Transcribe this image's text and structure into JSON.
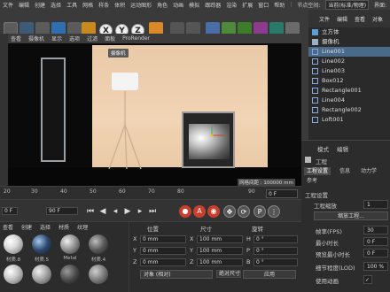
{
  "menu": {
    "items": [
      "文件",
      "编辑",
      "创建",
      "选择",
      "工具",
      "网格",
      "样条",
      "体积",
      "运动图形",
      "角色",
      "动画",
      "模拟",
      "跟踪器",
      "渲染",
      "扩展",
      "窗口",
      "帮助"
    ],
    "node_space_label": "节点空间:",
    "node_space_value": "当前(标准/物理)",
    "layout_label": "界面:"
  },
  "toolbar": {
    "xyz": [
      "X",
      "Y",
      "Z"
    ]
  },
  "viewport": {
    "menu": [
      "查看",
      "摄像机",
      "显示",
      "选项",
      "过滤",
      "面板",
      "ProRender"
    ],
    "camera_tag": "摄像机",
    "grid_spacing": "网格间距 : 100000 mm"
  },
  "timeline": {
    "ticks": [
      "20",
      "30",
      "40",
      "50",
      "60",
      "70",
      "80",
      "90"
    ],
    "current_frame": "0 F",
    "start_frame": "0 F",
    "end_frame": "90 F"
  },
  "materials": {
    "menu": [
      "查看",
      "创建",
      "编辑",
      "功能",
      "纹理"
    ],
    "tabs": [
      "查看",
      "创建",
      "选择",
      "材质",
      "纹理"
    ],
    "row1": [
      {
        "label": "材质.8",
        "color": "#d8d8d8"
      },
      {
        "label": "材质.5",
        "color": "#2e4a6e"
      },
      {
        "label": "Metal",
        "color": "#8c8c8c"
      },
      {
        "label": "材质.4",
        "color": "#5a5a5a"
      }
    ],
    "row2_colors": [
      "#c4c4c4",
      "#a7a7a7",
      "#4a4a4a",
      "#7a7a7a"
    ]
  },
  "coordinates": {
    "col_position": "位置",
    "col_size": "尺寸",
    "col_rotation": "旋转",
    "rows": [
      {
        "axis": "X",
        "pos": "0 mm",
        "size": "100 mm",
        "rot_axis": "H",
        "rot": "0 °"
      },
      {
        "axis": "Y",
        "pos": "0 mm",
        "size": "100 mm",
        "rot_axis": "P",
        "rot": "0 °"
      },
      {
        "axis": "Z",
        "pos": "0 mm",
        "size": "100 mm",
        "rot_axis": "B",
        "rot": "0 °"
      }
    ],
    "object_mode": "对象 (相对)",
    "size_mode": "绝对尺寸",
    "apply_label": "应用"
  },
  "objects": {
    "tabs": [
      "文件",
      "编辑",
      "查看",
      "对象"
    ],
    "items": [
      {
        "name": "立方体",
        "selected": false,
        "color": "#5aa0d8"
      },
      {
        "name": "摄像机",
        "selected": false,
        "color": "#9bb0c4"
      },
      {
        "name": "Line001",
        "selected": true,
        "color": "#88aadd"
      },
      {
        "name": "Line002",
        "selected": false,
        "color": "#88aadd"
      },
      {
        "name": "Line003",
        "selected": false,
        "color": "#88aadd"
      },
      {
        "name": "Box012",
        "selected": false,
        "color": "#88aadd"
      },
      {
        "name": "Rectangle001",
        "selected": false,
        "color": "#88aadd"
      },
      {
        "name": "Line004",
        "selected": false,
        "color": "#88aadd"
      },
      {
        "name": "Rectangle002",
        "selected": false,
        "color": "#88aadd"
      },
      {
        "name": "Loft001",
        "selected": false,
        "color": "#88aadd"
      }
    ]
  },
  "attributes": {
    "menu": [
      "模式",
      "编辑"
    ],
    "header": "工程",
    "tabs": [
      "工程设置",
      "信息",
      "动力学"
    ],
    "subtab": "参考",
    "section": "工程设置",
    "scale_label": "工程缩放",
    "scale_value": "1",
    "scale_btn": "缩放工程...",
    "rows": [
      {
        "label": "帧率(FPS)",
        "value": "30"
      },
      {
        "label": "最小时长",
        "value": "0 F"
      },
      {
        "label": "预览最小时长",
        "value": "0 F"
      },
      {
        "label": "细节程度(LOD)",
        "value": "100 %"
      },
      {
        "label": "使用动画",
        "value": "✓"
      }
    ]
  }
}
